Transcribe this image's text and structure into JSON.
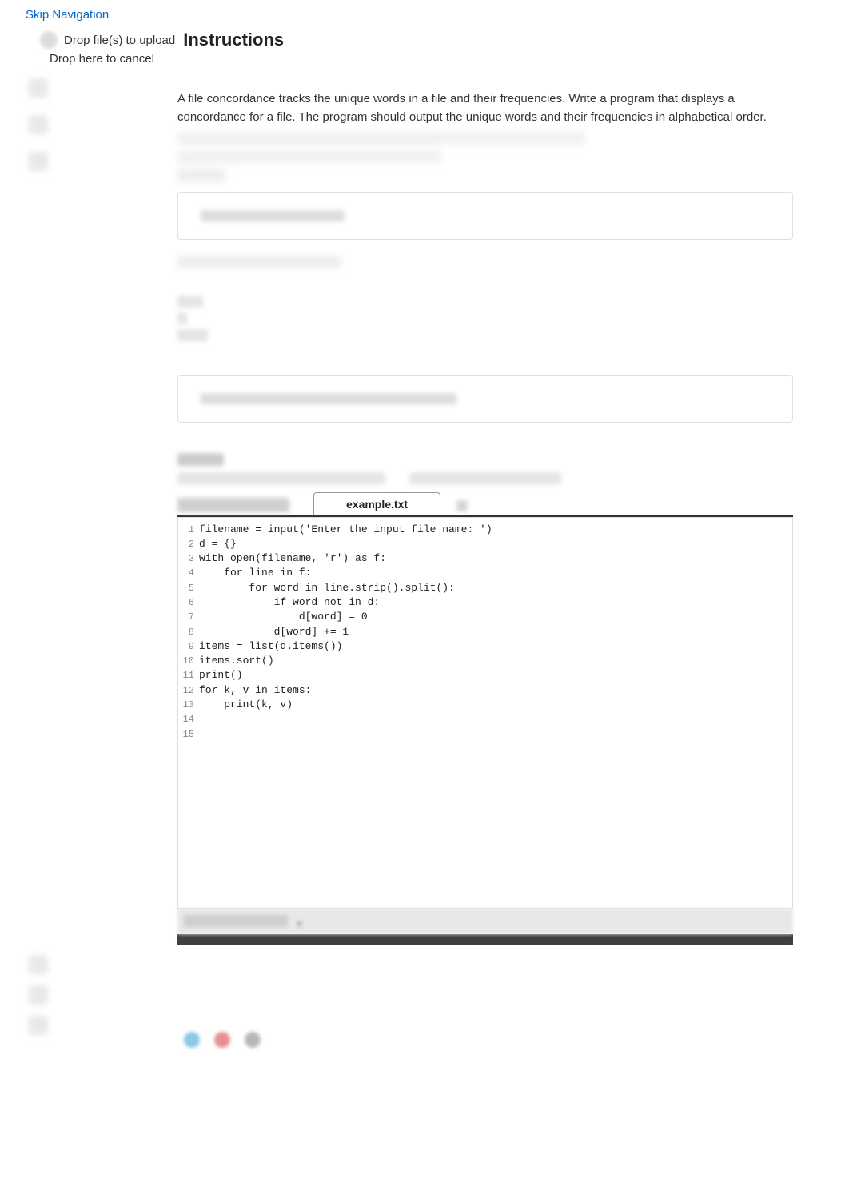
{
  "skip_nav": "Skip Navigation",
  "upload": {
    "drop_upload": "Drop file(s) to upload",
    "drop_cancel": "Drop here to cancel"
  },
  "heading": "Instructions",
  "instructions_paragraph": "A file concordance tracks the unique words in a file and their frequencies. Write a program that displays a concordance for a file. The program should output the unique words and their frequencies in alphabetical order.",
  "tab_label": "example.txt",
  "code_lines": [
    "filename = input('Enter the input file name: ')",
    "d = {}",
    "with open(filename, 'r') as f:",
    "    for line in f:",
    "        for word in line.strip().split():",
    "            if word not in d:",
    "                d[word] = 0",
    "            d[word] += 1",
    "items = list(d.items())",
    "items.sort()",
    "print()",
    "for k, v in items:",
    "    print(k, v)",
    "",
    ""
  ]
}
